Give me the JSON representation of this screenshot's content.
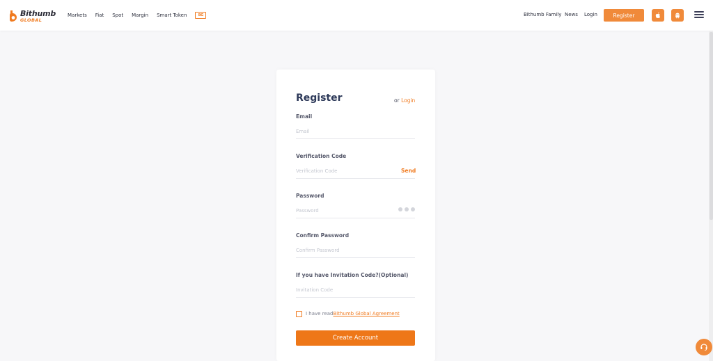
{
  "brand": {
    "name_line1": "Bithumb",
    "name_line2": "GLOBAL",
    "accent_color": "#f07a1f"
  },
  "nav": {
    "left_items": [
      "Markets",
      "Fiat",
      "Spot",
      "Margin",
      "Smart Token"
    ],
    "badge_label": "BG",
    "right_items": [
      "Bithumb Family",
      "News",
      "Login"
    ],
    "register_label": "Register",
    "apps": [
      {
        "icon": "apple-icon"
      },
      {
        "icon": "android-icon"
      }
    ],
    "menu_icon": "hamburger-menu-icon"
  },
  "form": {
    "title": "Register",
    "or_label": "or",
    "login_link": "Login",
    "fields": [
      {
        "label": "Email",
        "placeholder": "Email"
      },
      {
        "label": "Verification Code",
        "placeholder": "Verification Code",
        "action": "Send"
      },
      {
        "label": "Password",
        "placeholder": "Password"
      },
      {
        "label": "Confirm Password",
        "placeholder": "Confirm Password"
      },
      {
        "label": "If you have Invitation Code?(Optional)",
        "placeholder": "Invitation Code"
      }
    ],
    "agreement_text": "I have read",
    "agreement_link": "Bithumb Global Agreement",
    "submit_label": "Create Account"
  },
  "support": {
    "icon": "headset-icon"
  }
}
